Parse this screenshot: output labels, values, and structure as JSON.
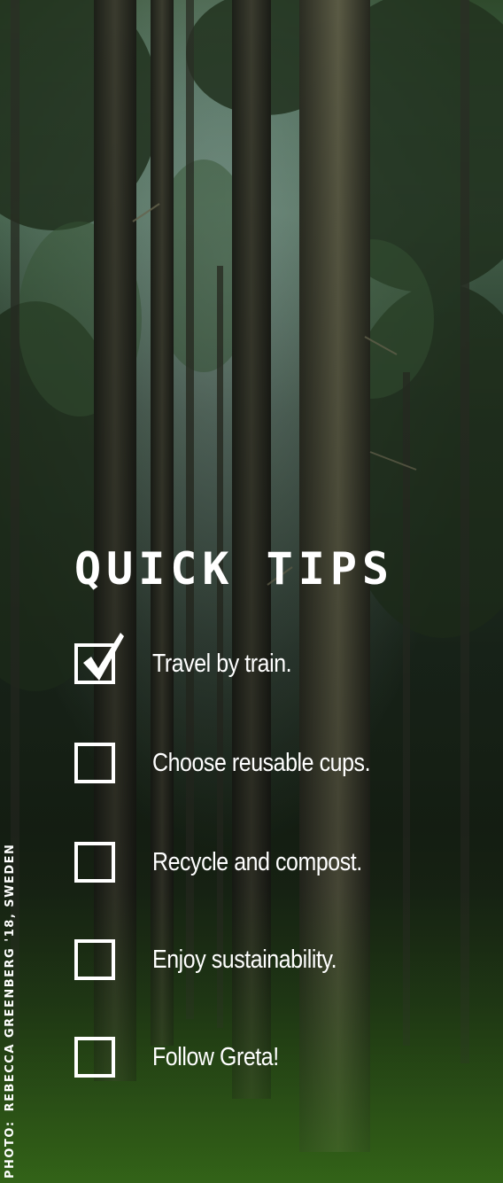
{
  "title": "QUICK TIPS",
  "tips": [
    {
      "label": "Travel by train.",
      "checked": true
    },
    {
      "label": "Choose reusable cups.",
      "checked": false
    },
    {
      "label": "Recycle and compost.",
      "checked": false
    },
    {
      "label": "Enjoy sustainability.",
      "checked": false
    },
    {
      "label": "Follow Greta!",
      "checked": false
    }
  ],
  "credit": {
    "prefix": "PHOTO:",
    "text": "REBECCA GREENBERG '18, SWEDEN"
  },
  "colors": {
    "text": "#ffffff",
    "forest_dark": "#1a2718",
    "forest_light": "#4a6a52",
    "moss": "#2a4a16"
  },
  "background": "forest photo"
}
